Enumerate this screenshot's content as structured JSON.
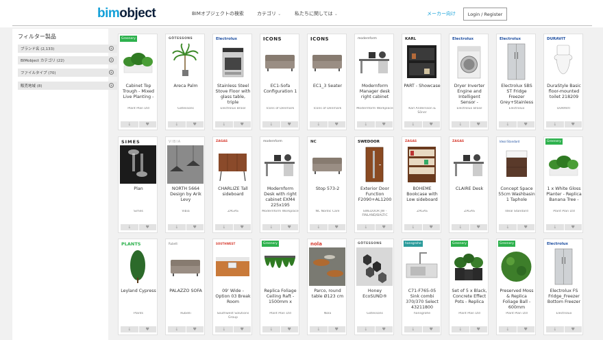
{
  "header": {
    "logo_b": "bim",
    "logo_o": "object",
    "nav_search": "BIMオブジェクトの検索",
    "nav_category": "カテゴリ",
    "nav_about": "私たちに関しては",
    "for_makers": "メーカー向け",
    "login": "Login / Register"
  },
  "sidebar": {
    "title": "フィルター製品",
    "filters": [
      {
        "label": "ブランド名 (2,133)"
      },
      {
        "label": "BIMobject カテゴリ (22)"
      },
      {
        "label": "ファイルタイプ (70)"
      },
      {
        "label": "販売地域 (8)"
      }
    ]
  },
  "colors": {
    "accent": "#13a0d8",
    "brand_green": "#2db14d",
    "brand_blue": "#1d4ea0",
    "brand_red": "#d63b2f"
  },
  "products": [
    {
      "brand": "Greenery",
      "title": "Cabinet Top Trough - Mixed Live Planting -",
      "maker": "Plant Plan Ltd",
      "icon": "plant-icon"
    },
    {
      "brand": "GÖTESSONS",
      "title": "Areca Palm",
      "maker": "Götessons",
      "icon": "palm-icon"
    },
    {
      "brand": "Electrolux",
      "title": "Stainless Steel Stove Floor with glass table, triple",
      "maker": "Electrolux Brasil",
      "icon": "stove-icon"
    },
    {
      "brand": "ICONS",
      "title": "EC1-Sofa Configuration 1",
      "maker": "Icons of Denmark",
      "icon": "sofa-icon"
    },
    {
      "brand": "ICONS",
      "title": "EC1_3 Seater",
      "maker": "Icons of Denmark",
      "icon": "sofa-icon"
    },
    {
      "brand": "modernform",
      "title": "Modernform Manager desk right cabinet",
      "maker": "Modernform Workplace",
      "icon": "desk-icon"
    },
    {
      "brand": "KARL",
      "title": "PART - Showcase",
      "maker": "Karl Andersson & Söner",
      "icon": "showcase-icon"
    },
    {
      "brand": "Electrolux",
      "title": "Dryer Inverter Engine and Intelligent Sensor -",
      "maker": "Electrolux Brasil",
      "icon": "washer-icon"
    },
    {
      "brand": "Electrolux",
      "title": "Electrolux SBS ST Fridge Freezer Grey+Stainless",
      "maker": "Electrolux",
      "icon": "fridge-icon"
    },
    {
      "brand": "DURAVIT",
      "title": "DuraStyle Basic floor-mounted toilet 218209",
      "maker": "DURAVIT",
      "icon": "toilet-icon"
    },
    {
      "brand": "SIMES",
      "title": "Plan",
      "maker": "Simes",
      "icon": "wall-light-icon"
    },
    {
      "brand": "VIBIA",
      "title": "NORTH 5664 Design by Arik Levy",
      "maker": "Vibia",
      "icon": "pendant-lamp-icon"
    },
    {
      "brand": "ZAGAS",
      "title": "CHARLIZE Tall sideboard",
      "maker": "ZAGAS",
      "icon": "sideboard-icon"
    },
    {
      "brand": "modernform",
      "title": "Modernform Desk with right cabinet EXM4 225x195",
      "maker": "Modernform Workplace",
      "icon": "desk-icon"
    },
    {
      "brand": "NC",
      "title": "Stop 573-2",
      "maker": "NC Nordic Care",
      "icon": "sofa-icon"
    },
    {
      "brand": "SWEDOOR",
      "title": "Exterior Door Function F2090+AL1200",
      "maker": "SWEDOOR JW - FINLAND/BALTIC",
      "icon": "door-icon"
    },
    {
      "brand": "ZAGAS",
      "title": "BOHÈME Bookcase with Low sideboard",
      "maker": "ZAGAS",
      "icon": "bookcase-icon"
    },
    {
      "brand": "ZAGAS",
      "title": "CLAIRE Desk",
      "maker": "ZAGAS",
      "icon": "desk-icon"
    },
    {
      "brand": "Ideal Standard",
      "title": "Concept Space 55cm Washbasin 1 Taphole",
      "maker": "Ideal Standard",
      "icon": "washbasin-icon"
    },
    {
      "brand": "Greenery",
      "title": "1 x White Gloss Planter - Replica Banana Tree -",
      "maker": "Plant Plan Ltd",
      "icon": "plant-icon"
    },
    {
      "brand": "PLANTS",
      "title": "Leyland Cypress",
      "maker": "Plants",
      "icon": "tree-icon"
    },
    {
      "brand": "Rubelli",
      "title": "PALAZZO SOFA",
      "maker": "Rubelli",
      "icon": "sofa-icon"
    },
    {
      "brand": "SOUTHWEST",
      "title": "09' Wide - Option 03 Break Room",
      "maker": "Southwest Solutions Group",
      "icon": "cabinet-icon"
    },
    {
      "brand": "Greenery",
      "title": "Replica Foliage Ceiling Raft - 1500mm x",
      "maker": "Plant Plan Ltd",
      "icon": "foliage-icon"
    },
    {
      "brand": "nola",
      "title": "Parco, round table Ø123 cm",
      "maker": "Nola",
      "icon": "table-icon"
    },
    {
      "brand": "GÖTESSONS",
      "title": "Honey EcoSUND®",
      "maker": "Götessons",
      "icon": "hexagon-icon"
    },
    {
      "brand": "hansgrohe",
      "title": "C71-F765-05 Sink combi 370/370 Select 43211800",
      "maker": "hansgrohe",
      "icon": "sink-icon"
    },
    {
      "brand": "Greenery",
      "title": "Set of 5 x Black, Concrete Effect Pots - Replica",
      "maker": "Plant Plan Ltd",
      "icon": "pots-icon"
    },
    {
      "brand": "Greenery",
      "title": "Preserved Moss & Replica Foliage Ball - 600mm",
      "maker": "Plant Plan Ltd",
      "icon": "moss-ball-icon"
    },
    {
      "brand": "Electrolux",
      "title": "Electrolux FS Fridge_Freezer Bottom Freezer",
      "maker": "Electrolux",
      "icon": "fridge-icon"
    }
  ]
}
